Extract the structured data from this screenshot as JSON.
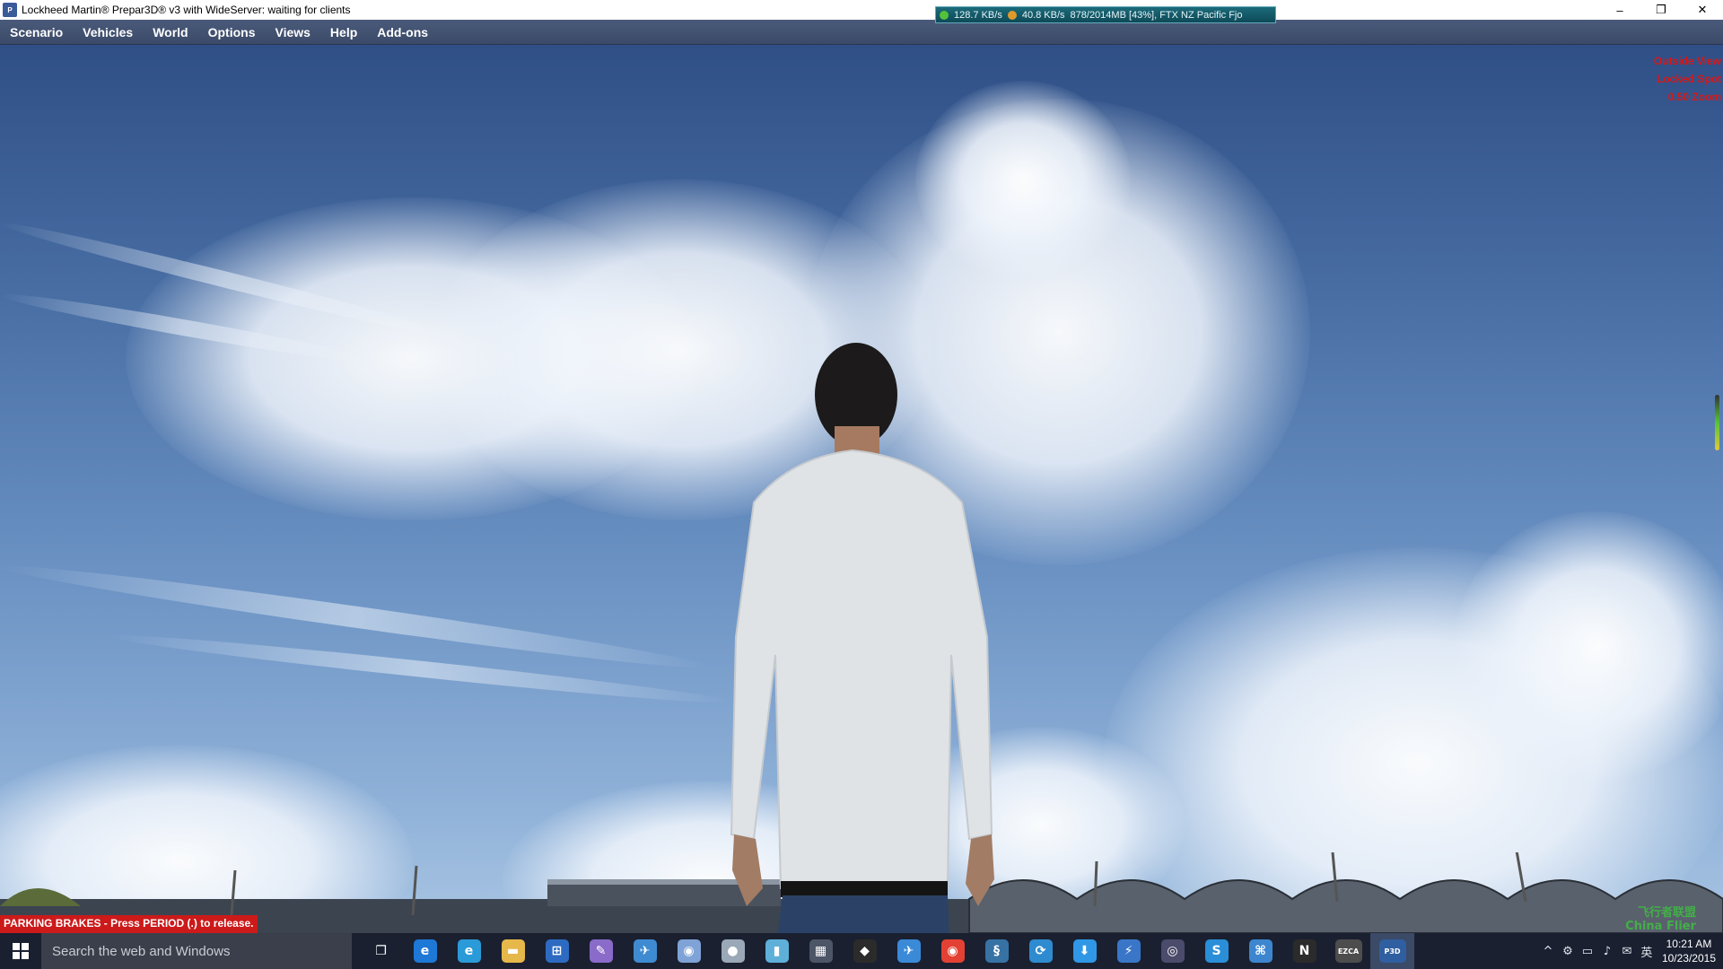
{
  "window": {
    "title": "Lockheed Martin® Prepar3D® v3 with WideServer: waiting for clients",
    "controls": [
      "–",
      "❐",
      "✕"
    ]
  },
  "status_strip": {
    "download": "128.7 KB/s",
    "upload": "40.8 KB/s",
    "memory": "878/2014MB [43%], FTX NZ Pacific Fjo"
  },
  "menu": [
    "Scenario",
    "Vehicles",
    "World",
    "Options",
    "Views",
    "Help",
    "Add-ons"
  ],
  "hud": [
    "Outside View",
    "Locked Spot",
    "0.50 Zoom"
  ],
  "parking_message": "PARKING BRAKES - Press PERIOD (.) to release.",
  "taskbar": {
    "search_placeholder": "Search the web and Windows",
    "apps": [
      {
        "name": "task-view",
        "glyph": "❐",
        "color": "transparent"
      },
      {
        "name": "edge",
        "glyph": "e",
        "color": "#1e78d6"
      },
      {
        "name": "internet-explorer",
        "glyph": "e",
        "color": "#2a9ad8"
      },
      {
        "name": "file-explorer",
        "glyph": "▬",
        "color": "#e6b84a"
      },
      {
        "name": "store",
        "glyph": "⊞",
        "color": "#2d6bc2"
      },
      {
        "name": "pen",
        "glyph": "✎",
        "color": "#8a6bc9"
      },
      {
        "name": "plane-app",
        "glyph": "✈",
        "color": "#3f8bd1"
      },
      {
        "name": "paint",
        "glyph": "◉",
        "color": "#7fa3d6"
      },
      {
        "name": "globe",
        "glyph": "●",
        "color": "#9aa8b8"
      },
      {
        "name": "notebook",
        "glyph": "▮",
        "color": "#5fb0d8"
      },
      {
        "name": "calculator",
        "glyph": "▦",
        "color": "#4d5666"
      },
      {
        "name": "qq",
        "glyph": "◆",
        "color": "#2b2b2b"
      },
      {
        "name": "flight-app",
        "glyph": "✈",
        "color": "#3a8ad8"
      },
      {
        "name": "chrome",
        "glyph": "◉",
        "color": "#e34133"
      },
      {
        "name": "python",
        "glyph": "§",
        "color": "#3772a4"
      },
      {
        "name": "sync",
        "glyph": "⟳",
        "color": "#2e8bd0"
      },
      {
        "name": "download-manager",
        "glyph": "⬇",
        "color": "#2f97e6"
      },
      {
        "name": "bolt-app",
        "glyph": "⚡",
        "color": "#3a76c8"
      },
      {
        "name": "disc-app",
        "glyph": "◎",
        "color": "#4b4b6b"
      },
      {
        "name": "s-app",
        "glyph": "S",
        "color": "#2a8fd8"
      },
      {
        "name": "network-app",
        "glyph": "⌘",
        "color": "#3d86cf"
      },
      {
        "name": "notepad-n",
        "glyph": "N",
        "color": "#2b2b2b"
      },
      {
        "name": "ezca",
        "glyph": "EZCA",
        "color": "#4d4d4d"
      },
      {
        "name": "p3d",
        "glyph": "P3D",
        "color": "#2f5fa0"
      }
    ],
    "tray_icons": [
      "^",
      "⚙",
      "▭",
      "♪",
      "✉",
      "英"
    ],
    "time": "10:21 AM",
    "date": "10/23/2015"
  },
  "watermark": {
    "line1": "飞行者联盟",
    "line2": "China Flier"
  },
  "colors": {
    "menu_bg": "#4a5a7a",
    "hud_text": "#d61818",
    "parking_bg": "#cc1a1a",
    "taskbar_bg": "#1a2030"
  }
}
